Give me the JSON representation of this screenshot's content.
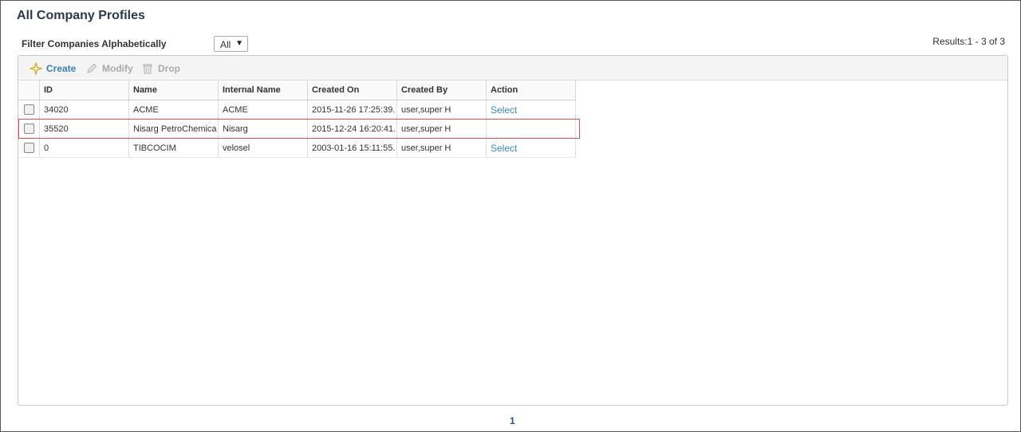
{
  "page": {
    "title": "All Company Profiles"
  },
  "filter": {
    "label": "Filter Companies Alphabetically",
    "selected": "All",
    "caret": "▼"
  },
  "results": {
    "text": "Results:1 - 3 of 3"
  },
  "toolbar": {
    "create_label": "Create",
    "modify_label": "Modify",
    "drop_label": "Drop",
    "create_icon": "star-icon",
    "modify_icon": "pencil-icon",
    "drop_icon": "trash-icon",
    "accent_color": "#3a7fbf"
  },
  "table": {
    "columns": [
      "ID",
      "Name",
      "Internal Name",
      "Created On",
      "Created By",
      "Action"
    ],
    "rows": [
      {
        "id": "34020",
        "name": "ACME",
        "internal_name": "ACME",
        "created_on": "2015-11-26 17:25:39.",
        "created_by": "user,super H",
        "action": "Select"
      },
      {
        "id": "35520",
        "name": "Nisarg PetroChemica",
        "internal_name": "Nisarg",
        "created_on": "2015-12-24 16:20:41.",
        "created_by": "user,super H",
        "action": ""
      },
      {
        "id": "0",
        "name": "TIBCOCIM",
        "internal_name": "velosel",
        "created_on": "2003-01-16 15:11:55.",
        "created_by": "user,super H",
        "action": "Select"
      }
    ],
    "highlighted_row": 1,
    "highlight_color": "#d9534f"
  },
  "pagination": {
    "current_page": "1"
  }
}
